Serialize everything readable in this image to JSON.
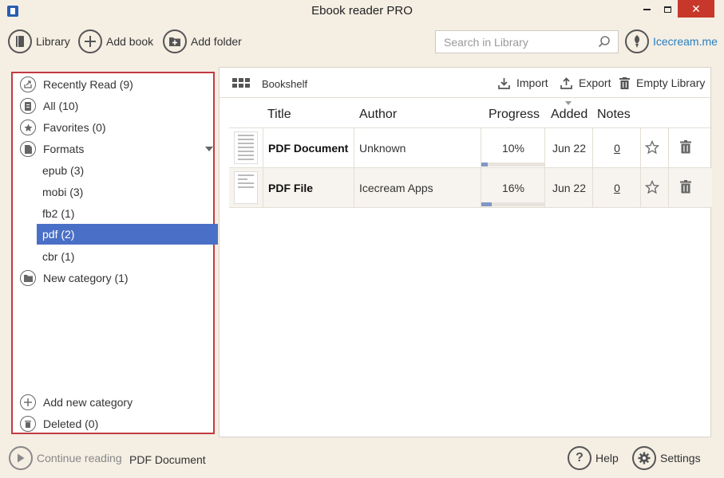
{
  "window": {
    "title": "Ebook reader PRO",
    "minimize_glyph": "",
    "close_glyph": "✕"
  },
  "toolbar": {
    "library_label": "Library",
    "add_book_label": "Add book",
    "add_folder_label": "Add folder",
    "search_placeholder": "Search in Library",
    "brand_link": "Icecream.me"
  },
  "sidebar": {
    "items": [
      {
        "label": "Recently Read (9)",
        "icon": "share-icon"
      },
      {
        "label": "All (10)",
        "icon": "books-icon"
      },
      {
        "label": "Favorites (0)",
        "icon": "star-icon"
      },
      {
        "label": "Formats",
        "icon": "document-icon"
      },
      {
        "label": "epub (3)"
      },
      {
        "label": "mobi (3)"
      },
      {
        "label": "fb2 (1)"
      },
      {
        "label": "pdf (2)",
        "selected": true
      },
      {
        "label": "cbr (1)"
      },
      {
        "label": "New category (1)",
        "icon": "folder-icon"
      }
    ],
    "add_category_label": "Add new category",
    "deleted_label": "Deleted (0)"
  },
  "shelf": {
    "view_label": "Bookshelf",
    "import_label": "Import",
    "export_label": "Export",
    "empty_label": "Empty Library"
  },
  "table": {
    "headers": {
      "title": "Title",
      "author": "Author",
      "progress": "Progress",
      "added": "Added",
      "notes": "Notes"
    },
    "rows": [
      {
        "title": "PDF Document",
        "author": "Unknown",
        "progress": "10%",
        "progress_value": 0.1,
        "added": "Jun 22",
        "notes": "0"
      },
      {
        "title": "PDF File",
        "author": "Icecream Apps",
        "progress": "16%",
        "progress_value": 0.16,
        "added": "Jun 22",
        "notes": "0"
      }
    ]
  },
  "status": {
    "continue_label": "Continue reading",
    "current_doc": "PDF Document",
    "help_label": "Help",
    "settings_label": "Settings"
  },
  "colors": {
    "accent": "#4a6fc7",
    "sidebar_border": "#c23a3f",
    "close_button": "#c7382b",
    "brand_link": "#2a7fc0",
    "background": "#f4eee3"
  }
}
